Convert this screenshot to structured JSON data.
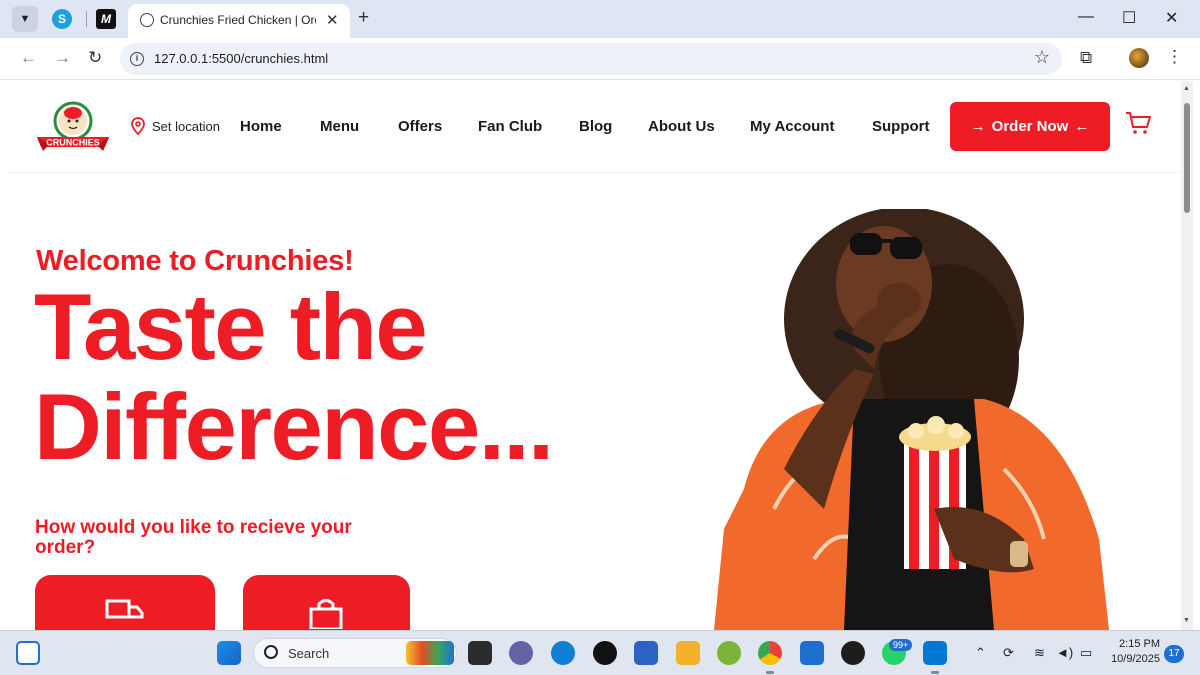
{
  "browser": {
    "active_tab_title": "Crunchies Fried Chicken | Order",
    "new_tab_symbol": "+",
    "url": "127.0.0.1:5500/crunchies.html",
    "pinned_tabs": [
      "skype-icon",
      "medium-icon"
    ]
  },
  "header": {
    "logo_text": "CRUNCHIES",
    "set_location": "Set location",
    "nav": [
      "Home",
      "Menu",
      "Offers",
      "Fan Club",
      "Blog",
      "About Us",
      "My Account",
      "Support"
    ],
    "order_button": "Order Now"
  },
  "hero": {
    "welcome": "Welcome to Crunchies!",
    "headline_line1": "Taste the",
    "headline_line2": "Difference...",
    "receive_question": "How would you like to recieve your order?",
    "delivery_options": [
      "truck-icon",
      "shopping-bag-icon"
    ]
  },
  "taskbar": {
    "search_label": "Search",
    "whatsapp_badge": "99+",
    "time": "2:15 PM",
    "date": "10/9/2025",
    "notification_count": "17"
  },
  "colors": {
    "brand_red": "#ee1c25",
    "tabbar": "#dfe6f3"
  }
}
